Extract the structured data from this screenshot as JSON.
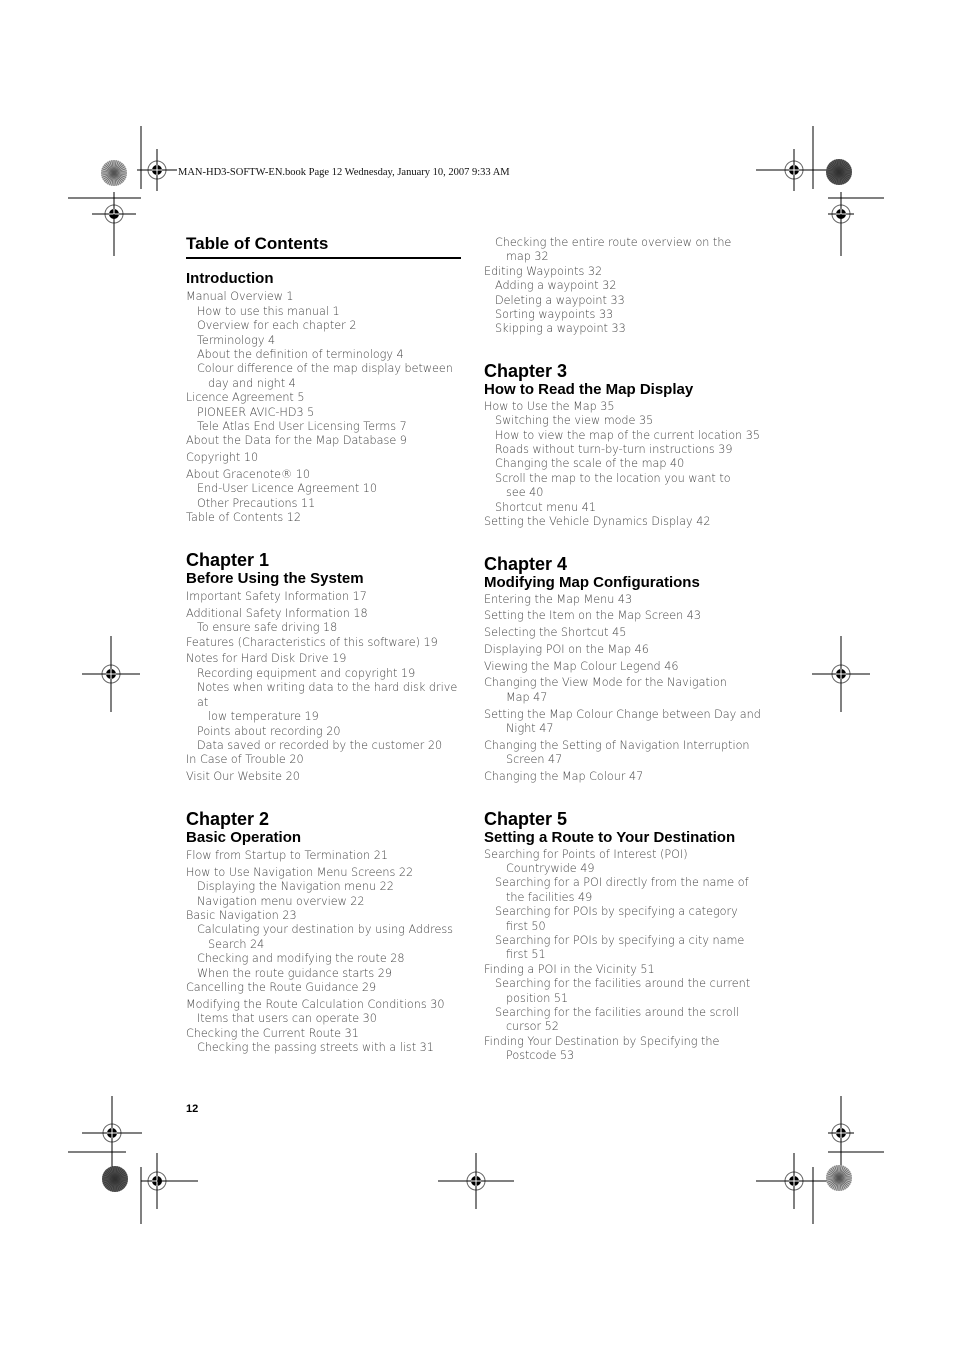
{
  "header": {
    "print_info": "MAN-HD3-SOFTW-EN.book  Page 12  Wednesday, January 10, 2007  9:33 AM"
  },
  "toc": {
    "title": "Table of Contents",
    "page_number": "12",
    "left_column": {
      "introduction": {
        "heading": "Introduction",
        "entries": [
          {
            "level": 1,
            "text": "Manual Overview  1"
          },
          {
            "level": 2,
            "text": "How to use this manual  1"
          },
          {
            "level": 2,
            "text": "Overview for each chapter  2"
          },
          {
            "level": 2,
            "text": "Terminology  4"
          },
          {
            "level": 2,
            "text": "About the definition of terminology  4"
          },
          {
            "level": 2,
            "text": "Colour difference of the map display between",
            "wrap": "day and night  4"
          },
          {
            "level": 1,
            "text": "Licence Agreement  5",
            "tight": true
          },
          {
            "level": 2,
            "text": "PIONEER AVIC-HD3  5"
          },
          {
            "level": 2,
            "text": "Tele Atlas End User Licensing Terms  7"
          },
          {
            "level": 1,
            "text": "About the Data for the Map Database  9",
            "tight": true
          },
          {
            "level": 1,
            "text": "Copyright  10"
          },
          {
            "level": 1,
            "text": "About Gracenote®  10"
          },
          {
            "level": 2,
            "text": "End-User Licence Agreement  10"
          },
          {
            "level": 2,
            "text": "Other Precautions  11"
          },
          {
            "level": 1,
            "text": "Table of Contents  12",
            "tight": true
          }
        ]
      },
      "chapter1": {
        "chapter": "Chapter 1",
        "heading": "Before Using the System",
        "entries": [
          {
            "level": 1,
            "text": "Important Safety Information  17"
          },
          {
            "level": 1,
            "text": "Additional Safety Information  18"
          },
          {
            "level": 2,
            "text": "To ensure safe driving  18"
          },
          {
            "level": 1,
            "text": "Features (Characteristics of this software)  19",
            "tight": true
          },
          {
            "level": 1,
            "text": "Notes for Hard Disk Drive  19"
          },
          {
            "level": 2,
            "text": "Recording equipment and copyright  19"
          },
          {
            "level": 2,
            "text": "Notes when writing data to the hard disk drive at",
            "wrap": "low temperature  19"
          },
          {
            "level": 2,
            "text": "Points about recording  20"
          },
          {
            "level": 2,
            "text": "Data saved or recorded by the customer  20"
          },
          {
            "level": 1,
            "text": "In Case of Trouble  20",
            "tight": true
          },
          {
            "level": 1,
            "text": "Visit Our Website  20"
          }
        ]
      },
      "chapter2": {
        "chapter": "Chapter 2",
        "heading": "Basic Operation",
        "entries": [
          {
            "level": 1,
            "text": "Flow from Startup to Termination  21"
          },
          {
            "level": 1,
            "text": "How to Use Navigation Menu Screens  22"
          },
          {
            "level": 2,
            "text": "Displaying the Navigation menu  22"
          },
          {
            "level": 2,
            "text": "Navigation menu overview  22"
          },
          {
            "level": 1,
            "text": "Basic Navigation  23",
            "tight": true
          },
          {
            "level": 2,
            "text": "Calculating your destination by using Address",
            "wrap": "Search  24"
          },
          {
            "level": 2,
            "text": "Checking and modifying the route  28"
          },
          {
            "level": 2,
            "text": "When the route guidance starts  29"
          },
          {
            "level": 1,
            "text": "Cancelling the Route Guidance  29",
            "tight": true
          },
          {
            "level": 1,
            "text": "Modifying the Route Calculation Conditions  30"
          },
          {
            "level": 2,
            "text": "Items that users can operate  30"
          },
          {
            "level": 1,
            "text": "Checking the Current Route  31",
            "tight": true
          },
          {
            "level": 2,
            "text": "Checking the passing streets with a list  31"
          }
        ]
      }
    },
    "right_column": {
      "continued": {
        "entries": [
          {
            "level": 2,
            "text": "Checking the entire route overview on the",
            "wrap": "map  32"
          },
          {
            "level": 1,
            "text": "Editing Waypoints  32",
            "tight": true
          },
          {
            "level": 2,
            "text": "Adding a waypoint  32"
          },
          {
            "level": 2,
            "text": "Deleting a waypoint  33"
          },
          {
            "level": 2,
            "text": "Sorting waypoints  33"
          },
          {
            "level": 2,
            "text": "Skipping a waypoint  33"
          }
        ]
      },
      "chapter3": {
        "chapter": "Chapter 3",
        "heading": "How to Read the Map Display",
        "entries": [
          {
            "level": 1,
            "text": "How to Use the Map  35",
            "tight": true
          },
          {
            "level": 2,
            "text": "Switching the view mode  35"
          },
          {
            "level": 2,
            "text": "How to view the map of the current location  35"
          },
          {
            "level": 2,
            "text": "Roads without turn-by-turn instructions  39"
          },
          {
            "level": 2,
            "text": "Changing the scale of the map  40"
          },
          {
            "level": 2,
            "text": "Scroll the map to the location you want to",
            "wrap": "see  40"
          },
          {
            "level": 2,
            "text": "Shortcut menu  41"
          },
          {
            "level": 1,
            "text": "Setting the Vehicle Dynamics Display  42",
            "tight": true
          }
        ]
      },
      "chapter4": {
        "chapter": "Chapter 4",
        "heading": "Modifying Map Configurations",
        "entries": [
          {
            "level": 1,
            "text": "Entering the Map Menu  43",
            "tight": true
          },
          {
            "level": 1,
            "text": "Setting the Item on the Map Screen  43"
          },
          {
            "level": 1,
            "text": "Selecting the Shortcut  45"
          },
          {
            "level": 1,
            "text": "Displaying POI on the Map  46"
          },
          {
            "level": 1,
            "text": "Viewing the Map Colour Legend  46"
          },
          {
            "level": 1,
            "text": "Changing the View Mode for the Navigation",
            "wrap": "Map  47"
          },
          {
            "level": 1,
            "text": "Setting the Map Colour Change between Day and",
            "wrap": "Night  47"
          },
          {
            "level": 1,
            "text": "Changing the Setting of Navigation Interruption",
            "wrap": "Screen  47"
          },
          {
            "level": 1,
            "text": "Changing the Map Colour  47"
          }
        ]
      },
      "chapter5": {
        "chapter": "Chapter 5",
        "heading": "Setting a Route to Your Destination",
        "entries": [
          {
            "level": 1,
            "text": "Searching for Points of Interest (POI)",
            "wrap": "Countrywide  49",
            "tight": true
          },
          {
            "level": 2,
            "text": "Searching for a POI directly from the name of",
            "wrap": "the facilities  49"
          },
          {
            "level": 2,
            "text": "Searching for POIs by specifying a category",
            "wrap": "first  50"
          },
          {
            "level": 2,
            "text": "Searching for POIs by specifying a city name",
            "wrap": "first  51"
          },
          {
            "level": 1,
            "text": "Finding a POI in the Vicinity  51",
            "tight": true
          },
          {
            "level": 2,
            "text": "Searching for the facilities around the current",
            "wrap": "position  51"
          },
          {
            "level": 2,
            "text": "Searching for the facilities around the scroll",
            "wrap": "cursor  52"
          },
          {
            "level": 1,
            "text": "Finding Your Destination by Specifying the",
            "wrap": "Postcode  53",
            "tight": true
          }
        ]
      }
    }
  }
}
